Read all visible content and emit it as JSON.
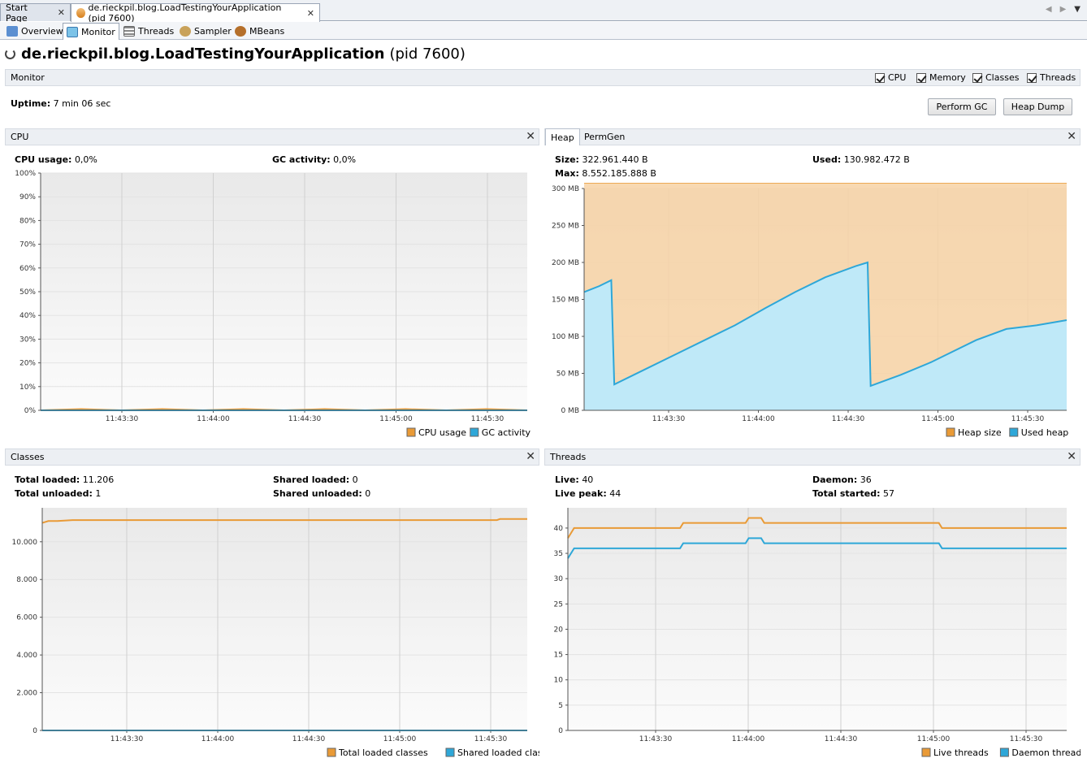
{
  "doc_tabs": [
    {
      "label": "Start Page",
      "close": "✕"
    },
    {
      "label": "de.rieckpil.blog.LoadTestingYourApplication (pid 7600)",
      "close": "✕"
    }
  ],
  "sub_tabs": [
    "Overview",
    "Monitor",
    "Threads",
    "Sampler",
    "MBeans"
  ],
  "app": {
    "name": "de.rieckpil.blog.LoadTestingYourApplication",
    "pid": "(pid 7600)"
  },
  "monitor": {
    "label": "Monitor",
    "checkboxes": [
      "CPU",
      "Memory",
      "Classes",
      "Threads"
    ],
    "uptime_label": "Uptime:",
    "uptime_value": "7 min 06 sec",
    "perform_gc": "Perform GC",
    "heap_dump": "Heap Dump"
  },
  "cpu": {
    "title": "CPU",
    "usage_label": "CPU usage:",
    "usage_value": "0,0%",
    "gc_label": "GC activity:",
    "gc_value": "0,0%"
  },
  "heap": {
    "tabs": [
      "Heap",
      "PermGen"
    ],
    "size_label": "Size:",
    "size_value": "322.961.440 B",
    "max_label": "Max:",
    "max_value": "8.552.185.888 B",
    "used_label": "Used:",
    "used_value": "130.982.472 B"
  },
  "classes": {
    "title": "Classes",
    "total_loaded_label": "Total loaded:",
    "total_loaded_value": "11.206",
    "total_unloaded_label": "Total unloaded:",
    "total_unloaded_value": "1",
    "shared_loaded_label": "Shared loaded:",
    "shared_loaded_value": "0",
    "shared_unloaded_label": "Shared unloaded:",
    "shared_unloaded_value": "0"
  },
  "threads": {
    "title": "Threads",
    "live_label": "Live:",
    "live_value": "40",
    "peak_label": "Live peak:",
    "peak_value": "44",
    "daemon_label": "Daemon:",
    "daemon_value": "36",
    "started_label": "Total started:",
    "started_value": "57"
  },
  "colors": {
    "orange": "#e99a36",
    "blue": "#2ea7d8",
    "orange_fill": "#f7d2a4",
    "blue_fill": "#bfe9f8"
  },
  "chart_data": [
    {
      "type": "line",
      "name": "cpu",
      "x_ticks": [
        "11:43:30",
        "11:44:00",
        "11:44:30",
        "11:45:00",
        "11:45:30"
      ],
      "y_ticks": [
        "0%",
        "10%",
        "20%",
        "30%",
        "40%",
        "50%",
        "60%",
        "70%",
        "80%",
        "90%",
        "100%"
      ],
      "ylim": [
        0,
        100
      ],
      "legend": [
        "CPU usage",
        "GC activity"
      ],
      "series": [
        {
          "name": "CPU usage",
          "values": [
            0,
            0.5,
            0,
            0.5,
            0,
            0.5,
            0,
            0.5,
            0,
            0.5,
            0,
            0.5,
            0
          ]
        },
        {
          "name": "GC activity",
          "values": [
            0,
            0,
            0,
            0,
            0,
            0,
            0,
            0,
            0,
            0,
            0,
            0,
            0
          ]
        }
      ]
    },
    {
      "type": "area",
      "name": "heap",
      "x_ticks": [
        "11:43:30",
        "11:44:00",
        "11:44:30",
        "11:45:00",
        "11:45:30"
      ],
      "y_ticks": [
        "0 MB",
        "50 MB",
        "100 MB",
        "150 MB",
        "200 MB",
        "250 MB",
        "300 MB"
      ],
      "ylim": [
        0,
        300
      ],
      "legend": [
        "Heap size",
        "Used heap"
      ],
      "x": [
        0,
        5,
        9,
        10,
        20,
        30,
        40,
        50,
        60,
        70,
        80,
        90,
        94,
        95,
        105,
        115,
        120,
        130,
        140,
        150,
        160
      ],
      "series": [
        {
          "name": "Heap size",
          "values": [
            308,
            308,
            308,
            308,
            308,
            308,
            308,
            308,
            308,
            308,
            308,
            308,
            308,
            308,
            308,
            308,
            308,
            308,
            308,
            308,
            308
          ]
        },
        {
          "name": "Used heap",
          "values": [
            160,
            168,
            176,
            35,
            55,
            75,
            95,
            115,
            138,
            160,
            180,
            195,
            200,
            33,
            48,
            65,
            75,
            95,
            110,
            115,
            122
          ]
        }
      ]
    },
    {
      "type": "line",
      "name": "classes",
      "x_ticks": [
        "11:43:30",
        "11:44:00",
        "11:44:30",
        "11:45:00",
        "11:45:30"
      ],
      "y_ticks": [
        "0",
        "2.000",
        "4.000",
        "6.000",
        "8.000",
        "10.000"
      ],
      "ylim": [
        0,
        11800
      ],
      "legend": [
        "Total loaded classes",
        "Shared loaded classes"
      ],
      "x": [
        0,
        2,
        5,
        10,
        150,
        151,
        160
      ],
      "series": [
        {
          "name": "Total loaded classes",
          "values": [
            11000,
            11100,
            11100,
            11150,
            11150,
            11206,
            11206
          ]
        },
        {
          "name": "Shared loaded classes",
          "values": [
            0,
            0,
            0,
            0,
            0,
            0,
            0
          ]
        }
      ]
    },
    {
      "type": "line",
      "name": "threads",
      "x_ticks": [
        "11:43:30",
        "11:44:00",
        "11:44:30",
        "11:45:00",
        "11:45:30"
      ],
      "y_ticks": [
        "0",
        "5",
        "10",
        "15",
        "20",
        "25",
        "30",
        "35",
        "40"
      ],
      "ylim": [
        0,
        44
      ],
      "legend": [
        "Live threads",
        "Daemon threads"
      ],
      "x": [
        0,
        2,
        36,
        37,
        57,
        58,
        62,
        63,
        119,
        120,
        160
      ],
      "series": [
        {
          "name": "Live threads",
          "values": [
            38,
            40,
            40,
            41,
            41,
            42,
            42,
            41,
            41,
            40,
            40
          ]
        },
        {
          "name": "Daemon threads",
          "values": [
            34,
            36,
            36,
            37,
            37,
            38,
            38,
            37,
            37,
            36,
            36
          ]
        }
      ]
    }
  ]
}
